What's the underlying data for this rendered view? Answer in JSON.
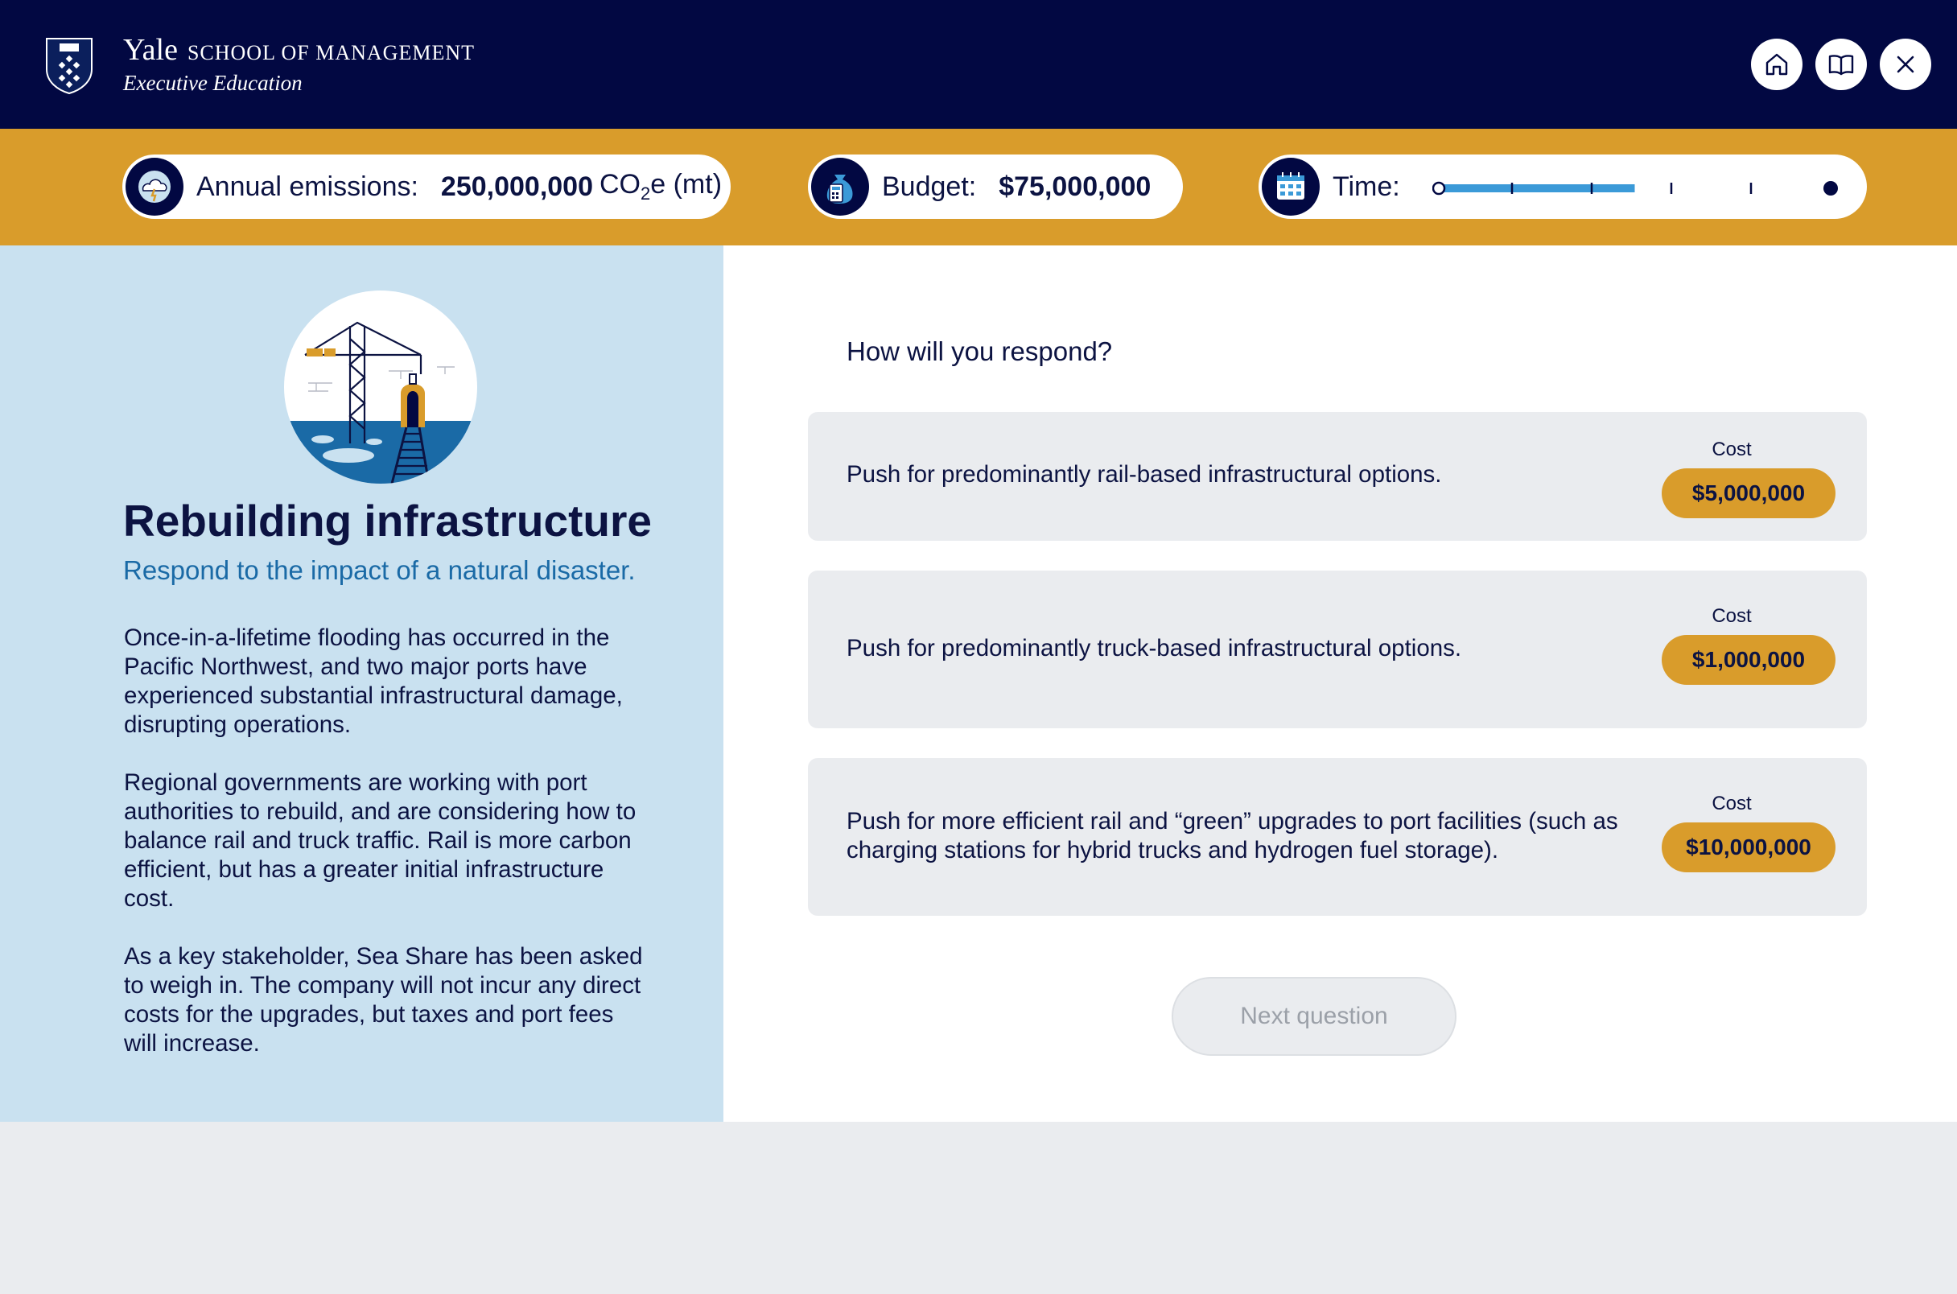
{
  "header": {
    "brand_name": "Yale",
    "brand_school": "School of Management",
    "brand_sub": "Executive Education",
    "home_icon": "home-icon",
    "book_icon": "book-icon",
    "close_icon": "close-icon"
  },
  "status": {
    "emissions_label": "Annual emissions:",
    "emissions_value": "250,000,000",
    "emissions_unit_pre": "CO",
    "emissions_unit_sub": "2",
    "emissions_unit_post": "e (mt)",
    "budget_label": "Budget:",
    "budget_value": "$75,000,000",
    "time_label": "Time:",
    "time_progress": 0.5
  },
  "scenario": {
    "title": "Rebuilding infrastructure",
    "subtitle": "Respond to the impact of a natural disaster.",
    "paragraphs": [
      "Once-in-a-lifetime flooding has occurred in the Pacific Northwest, and two major ports have experienced substantial infrastructural damage, disrupting operations.",
      "Regional governments are working with port authorities to rebuild, and are considering how to balance rail and truck traffic. Rail is more carbon efficient, but has a greater initial infrastructure cost.",
      "As a key stakeholder, Sea Share has been asked to weigh in. The company will not incur any direct costs for the upgrades, but taxes and port fees will increase."
    ]
  },
  "question": {
    "prompt": "How will you respond?",
    "options": [
      {
        "text": "Push for predominantly rail-based infrastructural options.",
        "cost_label": "Cost",
        "cost": "$5,000,000"
      },
      {
        "text": "Push for predominantly truck-based infrastructural options.",
        "cost_label": "Cost",
        "cost": "$1,000,000"
      },
      {
        "text": "Push for more efficient rail and “green” upgrades to port facilities (such as charging stations for hybrid trucks and hydrogen fuel storage).",
        "cost_label": "Cost",
        "cost": "$10,000,000"
      }
    ],
    "next_label": "Next question"
  },
  "colors": {
    "navy": "#020842",
    "gold": "#d99c2b",
    "light_blue": "#c9e1f0",
    "accent_blue": "#3b9ad8",
    "subtitle_blue": "#1a6aa6"
  }
}
